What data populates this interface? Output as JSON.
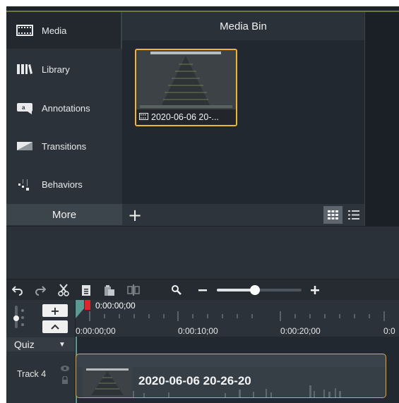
{
  "sidebar": {
    "items": [
      {
        "label": "Media",
        "icon": "film-strip-icon"
      },
      {
        "label": "Library",
        "icon": "library-books-icon"
      },
      {
        "label": "Annotations",
        "icon": "speech-bubble-icon"
      },
      {
        "label": "Transitions",
        "icon": "transition-icon"
      },
      {
        "label": "Behaviors",
        "icon": "behaviors-icon"
      }
    ],
    "more_label": "More"
  },
  "media_bin": {
    "title": "Media Bin",
    "items": [
      {
        "label": "2020-06-06 20-...",
        "selected": true
      }
    ],
    "add_label": "+"
  },
  "timeline": {
    "playhead_time": "0:00:00;00",
    "ruler_labels": [
      "0:00:00;00",
      "0:00:10;00",
      "0:00:20;00",
      "0:0"
    ],
    "quiz_label": "Quiz",
    "track_label": "Track 4",
    "clip_title": "2020-06-06 20-26-20",
    "zoom_level": 0.45
  },
  "colors": {
    "accent_selection": "#f1b534",
    "panel_dark": "#22282f",
    "panel_mid": "#2b3239",
    "playhead": "#e0242c"
  }
}
